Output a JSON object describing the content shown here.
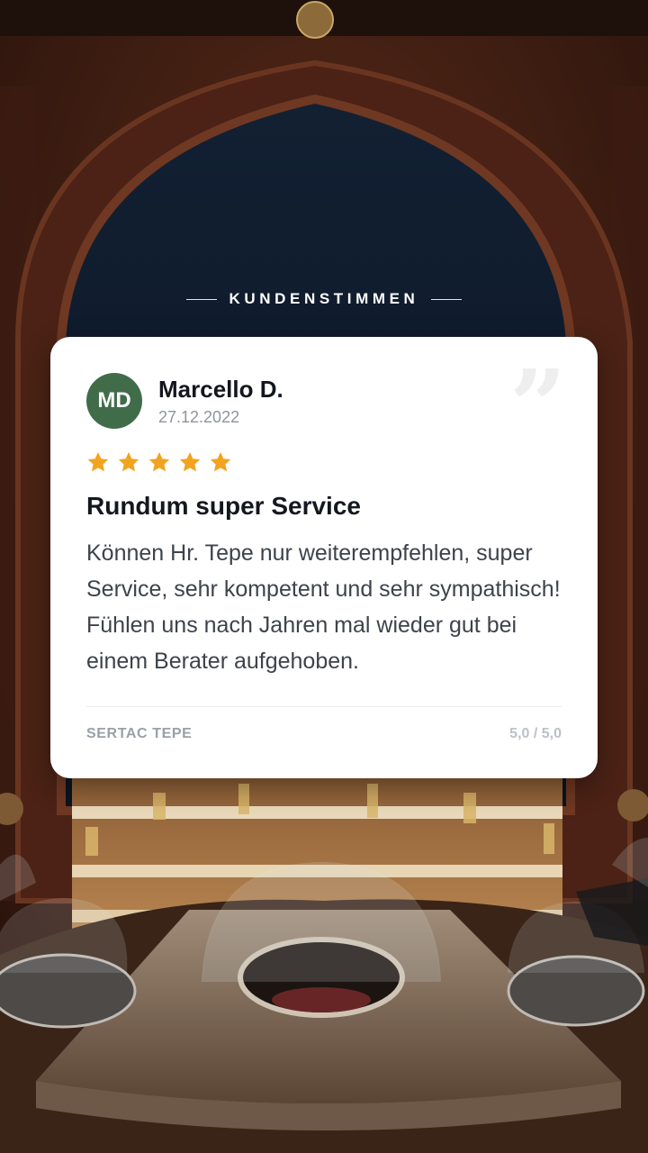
{
  "section": {
    "label": "KUNDENSTIMMEN"
  },
  "review": {
    "initials": "MD",
    "name": "Marcello D.",
    "date": "27.12.2022",
    "stars": 5,
    "title": "Rundum super Service",
    "text": "Können Hr. Tepe nur weiterempfehlen, super Service, sehr kompetent und sehr sympathisch! Fühlen uns nach Jahren mal wieder gut bei einem Berater aufgehoben.",
    "author": "SERTAC TEPE",
    "rating": "5,0 / 5,0"
  },
  "colors": {
    "accent_star": "#f2a31f",
    "avatar": "#416c4a",
    "card": "#ffffff"
  },
  "icons": {
    "quote": "quote-icon",
    "star": "star-icon"
  }
}
